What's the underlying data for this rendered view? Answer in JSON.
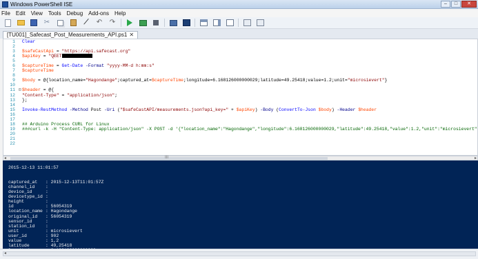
{
  "window": {
    "title": "Windows PowerShell ISE",
    "controls": {
      "minimize": "–",
      "maximize": "□",
      "close": "✕"
    }
  },
  "menu": [
    "File",
    "Edit",
    "View",
    "Tools",
    "Debug",
    "Add-ons",
    "Help"
  ],
  "toolbar": {
    "icons": [
      "new-icon",
      "open-icon",
      "save-icon",
      "cut-icon",
      "copy-icon",
      "paste-icon",
      "clear-icon",
      "undo-icon",
      "redo-icon",
      "run-icon",
      "run-selection-icon",
      "stop-icon",
      "remote-icon",
      "console-icon",
      "pane-top-icon",
      "pane-right-icon",
      "pane-max-icon",
      "commands-icon",
      "addon-icon"
    ]
  },
  "tab": {
    "label": "[TU001]_Safecast_Post_Measurements_API.ps1",
    "close": "✕"
  },
  "editor": {
    "lines": [
      {
        "num": "1",
        "fold": "",
        "text": "Clear"
      },
      {
        "num": "2",
        "fold": "",
        "text": ""
      },
      {
        "num": "3",
        "fold": "",
        "text": "$safeCastApi = \"https://api.safecast.org\""
      },
      {
        "num": "4",
        "fold": "",
        "text": "$apiKey = \"QEET"
      },
      {
        "num": "5",
        "fold": "",
        "text": ""
      },
      {
        "num": "6",
        "fold": "",
        "text": "$captureTime = Get-Date -Format \"yyyy-MM-d h:mm:s\""
      },
      {
        "num": "7",
        "fold": "",
        "text": "$captureTime"
      },
      {
        "num": "8",
        "fold": "",
        "text": ""
      },
      {
        "num": "9",
        "fold": "",
        "text": "$body = @{location_name=\"Hagondange\";captured_at=$captureTime;longitude=6.168126000000029;latitude=49.25418;value=1.2;unit=\"microsievert\"}"
      },
      {
        "num": "10",
        "fold": "",
        "text": ""
      },
      {
        "num": "11",
        "fold": "⊟",
        "text": "$header = @{"
      },
      {
        "num": "12",
        "fold": "",
        "text": "\"Content-Type\" = \"application/json\";"
      },
      {
        "num": "13",
        "fold": "",
        "text": "};"
      },
      {
        "num": "14",
        "fold": "",
        "text": ""
      },
      {
        "num": "15",
        "fold": "",
        "text": "Invoke-RestMethod -Method Post -Uri (\"$safeCastAPI/measurements.json?api_key=\" + $apiKey) -Body (ConvertTo-Json $body) -Header $header"
      },
      {
        "num": "16",
        "fold": "",
        "text": ""
      },
      {
        "num": "17",
        "fold": "",
        "text": ""
      },
      {
        "num": "18",
        "fold": "",
        "text": "## Arduino Process CURL for Linux"
      },
      {
        "num": "19",
        "fold": "",
        "text": "###curl -k -H \"Content-Type: application/json\" -X POST -d '{\"location_name\":\"Hagondange\",\"longitude\":6.168126000000029,\"latitude\":49.25418,\"value\":1.2,\"unit\":\"microsievert\""
      },
      {
        "num": "20",
        "fold": "",
        "text": ""
      },
      {
        "num": "21",
        "fold": "",
        "text": ""
      },
      {
        "num": "22",
        "fold": "",
        "text": ""
      }
    ]
  },
  "scroll": {
    "grip": "III",
    "left": "◂",
    "right": "▸"
  },
  "console": {
    "timestamp": "2015-12-13 11:01:57",
    "fields": [
      {
        "key": "captured_at",
        "value": "2015-12-13T11:01:57Z"
      },
      {
        "key": "channel_id",
        "value": ""
      },
      {
        "key": "device_id",
        "value": ""
      },
      {
        "key": "devicetype_id",
        "value": ""
      },
      {
        "key": "height",
        "value": ""
      },
      {
        "key": "id",
        "value": "56054319"
      },
      {
        "key": "location_name",
        "value": "Hagondange"
      },
      {
        "key": "original_id",
        "value": "56054319"
      },
      {
        "key": "sensor_id",
        "value": ""
      },
      {
        "key": "station_id",
        "value": ""
      },
      {
        "key": "unit",
        "value": "microsievert"
      },
      {
        "key": "user_id",
        "value": "902"
      },
      {
        "key": "value",
        "value": "1,2"
      },
      {
        "key": "latitude",
        "value": "49,25418"
      },
      {
        "key": "longitude",
        "value": "6,168126000000029"
      }
    ]
  },
  "colors": {
    "console_bg": "#012456",
    "variable": "#ff4500",
    "string": "#8b0000",
    "command": "#0000ff",
    "comment": "#006400",
    "line_number": "#2b91af"
  }
}
